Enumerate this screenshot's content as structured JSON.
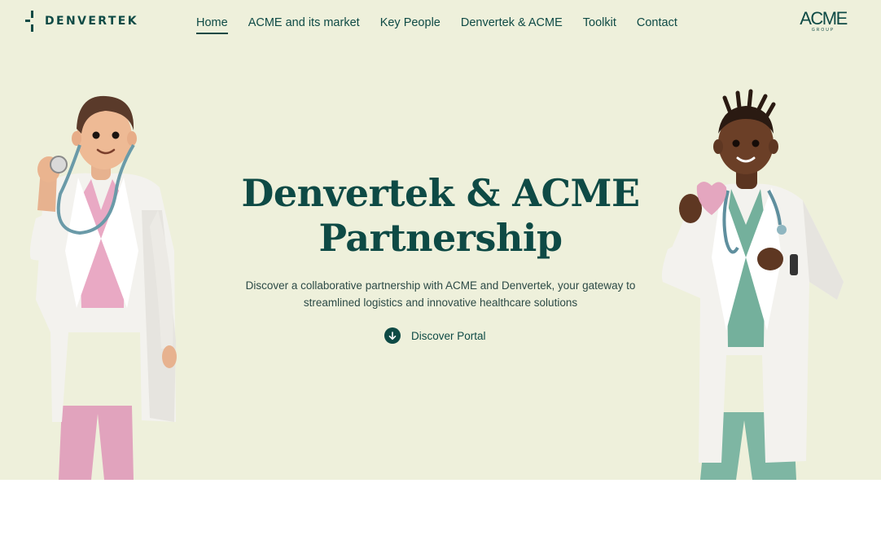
{
  "brand": {
    "name": "DENVERTEK"
  },
  "nav": {
    "items": [
      {
        "label": "Home",
        "active": true
      },
      {
        "label": "ACME and its market",
        "active": false
      },
      {
        "label": "Key People",
        "active": false
      },
      {
        "label": "Denvertek & ACME",
        "active": false
      },
      {
        "label": "Toolkit",
        "active": false
      },
      {
        "label": "Contact",
        "active": false
      }
    ]
  },
  "partner_logo": {
    "word": "ACME",
    "sub": "GROUP"
  },
  "hero": {
    "title_line1": "Denvertek & ACME",
    "title_line2": "Partnership",
    "subtitle_line1": "Discover a collaborative partnership with ACME and Denvertek, your gateway to",
    "subtitle_line2": "streamlined logistics and innovative healthcare solutions",
    "cta_label": "Discover Portal",
    "cta_icon": "arrow-down-circle-icon"
  },
  "colors": {
    "hero_bg": "#eef0db",
    "brand_green": "#0e4a45",
    "page_bg": "#ffffff"
  }
}
